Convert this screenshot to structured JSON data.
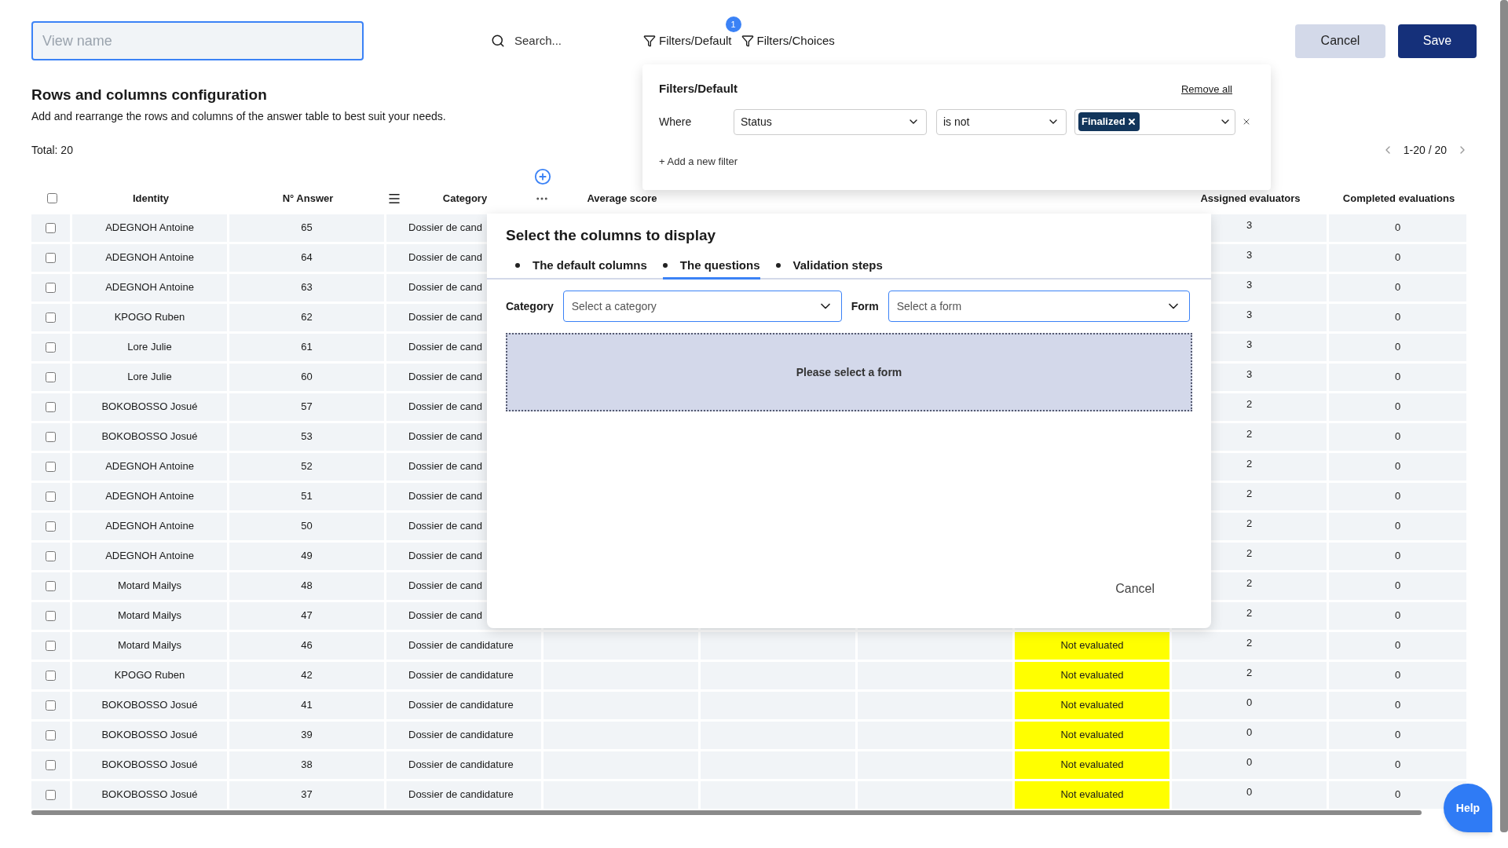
{
  "view_name": {
    "placeholder": "View name"
  },
  "search": {
    "placeholder": "Search..."
  },
  "filter_buttons": [
    {
      "label": "Filters/Default",
      "badge": "1"
    },
    {
      "label": "Filters/Choices"
    }
  ],
  "actions": [
    {
      "label": "Cancel",
      "kind": "secondary"
    },
    {
      "label": "Save",
      "kind": "primary"
    }
  ],
  "section": {
    "title": "Rows and columns configuration",
    "description": "Add and rearrange the rows and columns of the answer table to best suit your needs."
  },
  "total": "Total: 20",
  "pagination": "1-20 / 20",
  "filter_panel": {
    "title": "Filters/Default",
    "remove_all": "Remove all",
    "rules": [
      {
        "label": "Where",
        "field": "Status",
        "operator": "is not",
        "values": [
          "Finalized"
        ]
      }
    ],
    "add": "+ Add a new filter"
  },
  "table": {
    "select_all": {
      "checked": false
    },
    "columns": [
      "Identity",
      "N° Answer",
      "Category",
      "Average score",
      "Assigned evaluators",
      "Completed evaluations"
    ],
    "rows": [
      {
        "checked": false,
        "identity": "ADEGNOH Antoine",
        "answer": "65",
        "category": "Dossier de cand",
        "assigned": "3",
        "completed": "0"
      },
      {
        "checked": false,
        "identity": "ADEGNOH Antoine",
        "answer": "64",
        "category": "Dossier de cand",
        "assigned": "3",
        "completed": "0"
      },
      {
        "checked": false,
        "identity": "ADEGNOH Antoine",
        "answer": "63",
        "category": "Dossier de cand",
        "assigned": "3",
        "completed": "0"
      },
      {
        "checked": false,
        "identity": "KPOGO Ruben",
        "answer": "62",
        "category": "Dossier de cand",
        "assigned": "3",
        "completed": "0"
      },
      {
        "checked": false,
        "identity": "Lore Julie",
        "answer": "61",
        "category": "Dossier de cand",
        "assigned": "3",
        "completed": "0"
      },
      {
        "checked": false,
        "identity": "Lore Julie",
        "answer": "60",
        "category": "Dossier de cand",
        "assigned": "3",
        "completed": "0"
      },
      {
        "checked": false,
        "identity": "BOKOBOSSO Josué",
        "answer": "57",
        "category": "Dossier de cand",
        "assigned": "2",
        "completed": "0"
      },
      {
        "checked": false,
        "identity": "BOKOBOSSO Josué",
        "answer": "53",
        "category": "Dossier de cand",
        "assigned": "2",
        "completed": "0"
      },
      {
        "checked": false,
        "identity": "ADEGNOH Antoine",
        "answer": "52",
        "category": "Dossier de cand",
        "assigned": "2",
        "completed": "0"
      },
      {
        "checked": false,
        "identity": "ADEGNOH Antoine",
        "answer": "51",
        "category": "Dossier de cand",
        "assigned": "2",
        "completed": "0"
      },
      {
        "checked": false,
        "identity": "ADEGNOH Antoine",
        "answer": "50",
        "category": "Dossier de cand",
        "assigned": "2",
        "completed": "0"
      },
      {
        "checked": false,
        "identity": "ADEGNOH Antoine",
        "answer": "49",
        "category": "Dossier de cand",
        "assigned": "2",
        "completed": "0"
      },
      {
        "checked": false,
        "identity": "Motard Mailys",
        "answer": "48",
        "category": "Dossier de cand",
        "assigned": "2",
        "completed": "0"
      },
      {
        "checked": false,
        "identity": "Motard Mailys",
        "answer": "47",
        "category": "Dossier de cand",
        "assigned": "2",
        "completed": "0"
      },
      {
        "checked": false,
        "identity": "Motard Mailys",
        "answer": "46",
        "category": "Dossier de candidature",
        "status": "Not evaluated",
        "assigned": "2",
        "completed": "0"
      },
      {
        "checked": false,
        "identity": "KPOGO Ruben",
        "answer": "42",
        "category": "Dossier de candidature",
        "status": "Not evaluated",
        "assigned": "2",
        "completed": "0"
      },
      {
        "checked": false,
        "identity": "BOKOBOSSO Josué",
        "answer": "41",
        "category": "Dossier de candidature",
        "status": "Not evaluated",
        "assigned": "0",
        "completed": "0"
      },
      {
        "checked": false,
        "identity": "BOKOBOSSO Josué",
        "answer": "39",
        "category": "Dossier de candidature",
        "status": "Not evaluated",
        "assigned": "0",
        "completed": "0"
      },
      {
        "checked": false,
        "identity": "BOKOBOSSO Josué",
        "answer": "38",
        "category": "Dossier de candidature",
        "status": "Not evaluated",
        "assigned": "0",
        "completed": "0"
      },
      {
        "checked": false,
        "identity": "BOKOBOSSO Josué",
        "answer": "37",
        "category": "Dossier de candidature",
        "status": "Not evaluated",
        "assigned": "0",
        "completed": "0"
      }
    ]
  },
  "modal": {
    "title": "Select the columns to display",
    "tabs": [
      {
        "label": "The default columns",
        "selected": false
      },
      {
        "label": "The questions",
        "selected": true
      },
      {
        "label": "Validation steps",
        "selected": false
      }
    ],
    "fields": [
      {
        "label": "Category",
        "placeholder": "Select a category"
      },
      {
        "label": "Form",
        "placeholder": "Select a form"
      }
    ],
    "empty": "Please select a form",
    "cancel": "Cancel"
  },
  "help": "Help"
}
